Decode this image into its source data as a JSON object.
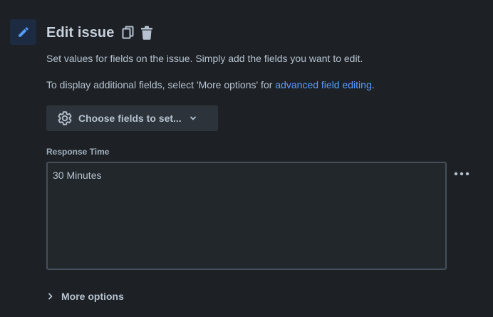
{
  "header": {
    "icon": "pencil-icon",
    "title": "Edit issue",
    "actions": [
      {
        "icon": "copy-icon"
      },
      {
        "icon": "trash-icon"
      }
    ]
  },
  "description": {
    "line1": "Set values for fields on the issue. Simply add the fields you want to edit.",
    "line2_prefix": "To display additional fields, select 'More options' for ",
    "line2_link": "advanced field editing",
    "line2_suffix": "."
  },
  "choose_fields": {
    "icon": "gear-icon",
    "label": "Choose fields to set...",
    "chevron": "chevron-down-icon"
  },
  "field": {
    "label": "Response Time",
    "value": "30 Minutes",
    "menu_icon": "more-horizontal-icon"
  },
  "more_options": {
    "icon": "chevron-right-icon",
    "label": "More options"
  },
  "colors": {
    "background": "#1d2125",
    "link": "#579dff",
    "text": "#b6c2cf",
    "button_bg": "#2c333a",
    "field_border": "#454f59"
  }
}
